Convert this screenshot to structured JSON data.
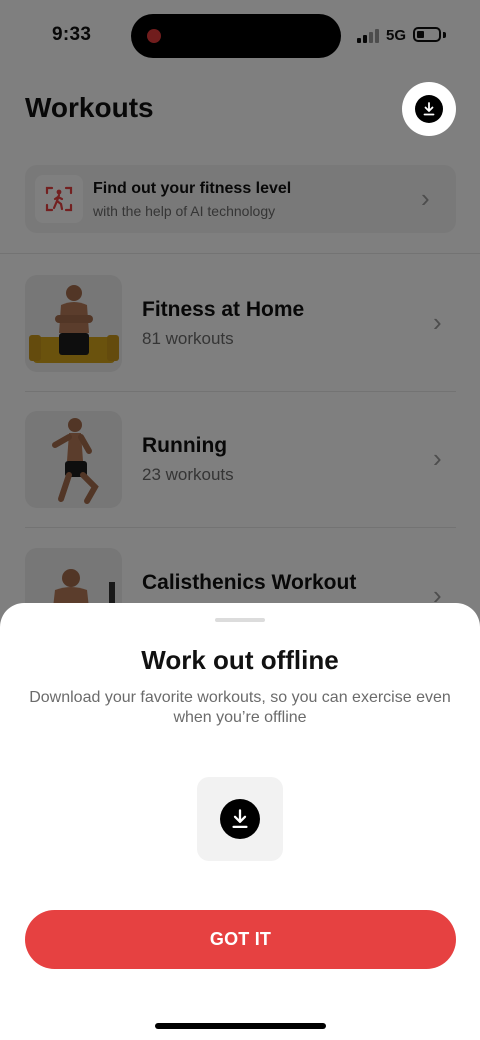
{
  "status_bar": {
    "time": "9:33",
    "network": "5G"
  },
  "header": {
    "title": "Workouts",
    "download_icon": "download-icon"
  },
  "fitness_card": {
    "title": "Find out your fitness level",
    "subtitle": "with the help of AI technology",
    "icon": "body-scan-icon"
  },
  "programs": [
    {
      "title": "Fitness at Home",
      "subtitle": "81 workouts"
    },
    {
      "title": "Running",
      "subtitle": "23 workouts"
    },
    {
      "title": "Calisthenics Workout",
      "subtitle": ""
    }
  ],
  "sheet": {
    "title": "Work out offline",
    "description": "Download your favorite workouts, so you can exercise even when you’re offline",
    "icon": "download-icon",
    "button_label": "GOT IT"
  },
  "colors": {
    "accent": "#e64141",
    "overlay": "rgba(0,0,0,0.5)"
  }
}
